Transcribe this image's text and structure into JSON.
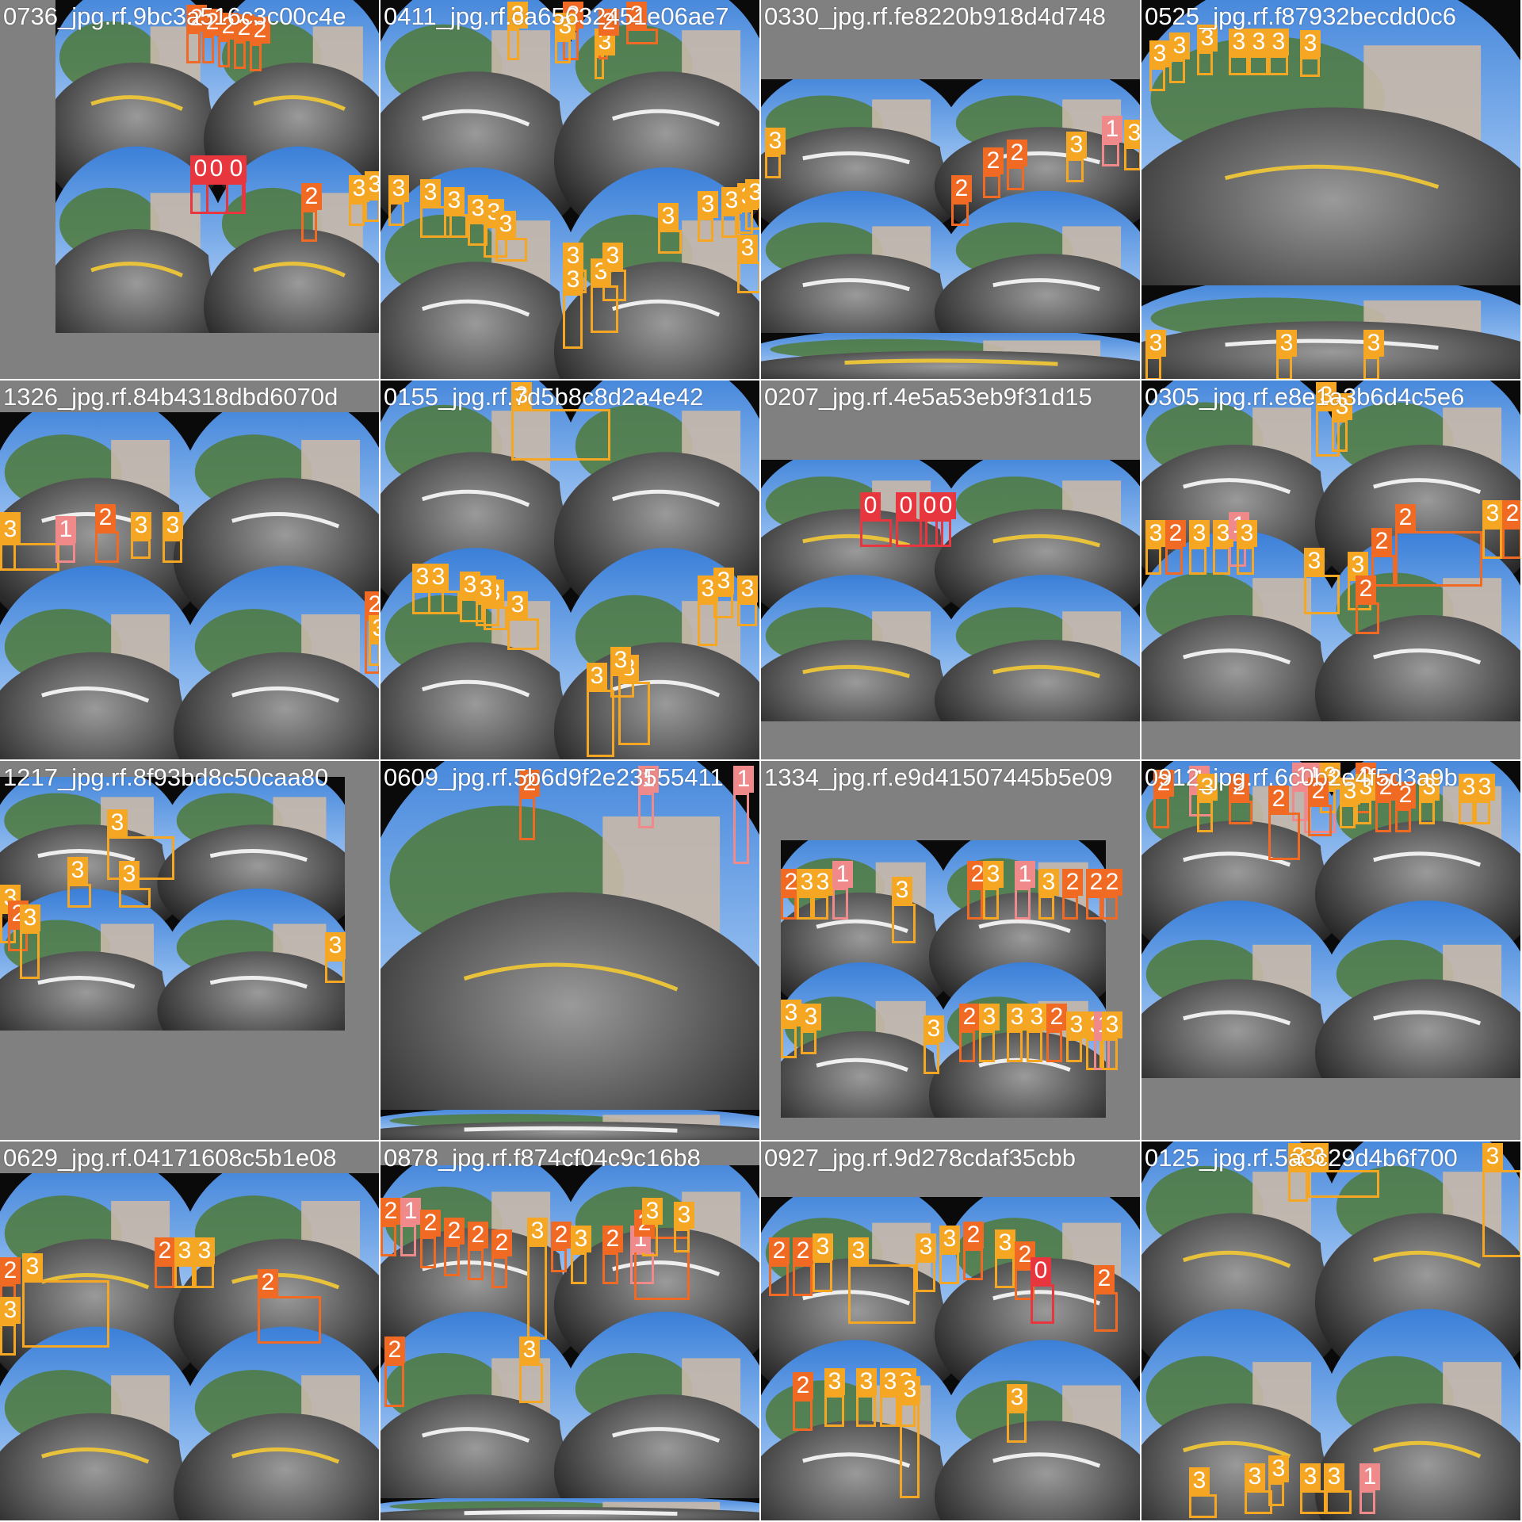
{
  "colors": {
    "class_0": "#e8363f",
    "class_1": "#f08a8a",
    "class_2": "#f06a24",
    "class_3": "#f5a623",
    "padding_gray": "#808080"
  },
  "mosaic": [
    {
      "filename": "0736_jpg.rf.9bc3a516c3c00c4e",
      "labels": [
        "2",
        "2",
        "2",
        "2",
        "2",
        "0",
        "0",
        "0",
        "0",
        "2",
        "3",
        "3"
      ]
    },
    {
      "filename": "0411_jpg.rf.ca65632451e06ae7",
      "labels": [
        "3",
        "2",
        "2",
        "3",
        "2",
        "3",
        "3",
        "3",
        "3",
        "3",
        "3",
        "3",
        "3",
        "3",
        "3",
        "3",
        "3",
        "3",
        "3",
        "3",
        "3",
        "3"
      ]
    },
    {
      "filename": "0330_jpg.rf.fe8220b918d4d748",
      "labels": [
        "3",
        "2",
        "2",
        "3",
        "1",
        "3",
        "2"
      ]
    },
    {
      "filename": "0525_jpg.rf.f87932becdd0c6",
      "labels": [
        "3",
        "3",
        "3",
        "3",
        "3",
        "3",
        "3",
        "3",
        "3",
        "3"
      ]
    },
    {
      "filename": "1326_jpg.rf.84b4318dbd6070d",
      "labels": [
        "3",
        "3",
        "1",
        "2",
        "3",
        "3",
        "2",
        "3"
      ]
    },
    {
      "filename": "0155_jpg.rf.7d5b8c8d2a4e42",
      "labels": [
        "3",
        "3",
        "3",
        "3",
        "3",
        "3",
        "3",
        "3",
        "3",
        "3",
        "3",
        "3",
        "3"
      ]
    },
    {
      "filename": "0207_jpg.rf.4e5a53eb9f31d15",
      "labels": [
        "0",
        "0",
        "0",
        "0"
      ]
    },
    {
      "filename": "0305_jpg.rf.e8e1a3b6d4c5e6",
      "labels": [
        "3",
        "3",
        "3",
        "2",
        "3",
        "3",
        "1",
        "3",
        "3",
        "3",
        "2",
        "2",
        "3",
        "2",
        "2"
      ]
    },
    {
      "filename": "1217_jpg.rf.8f93bd8c50caa80",
      "labels": [
        "3",
        "3",
        "3",
        "3",
        "2",
        "3",
        "3"
      ]
    },
    {
      "filename": "0609_jpg.rf.5b6d9f2e23555411",
      "labels": [
        "2",
        "1",
        "1"
      ]
    },
    {
      "filename": "1334_jpg.rf.e9d41507445b5e09",
      "labels": [
        "2",
        "3",
        "3",
        "1",
        "3",
        "2",
        "3",
        "1",
        "3",
        "2",
        "2",
        "2",
        "3",
        "3",
        "3",
        "2",
        "3",
        "3",
        "3",
        "2",
        "3",
        "3",
        "1",
        "3"
      ]
    },
    {
      "filename": "0912_jpg.rf.6c0b2e4f5d3a9b",
      "labels": [
        "1",
        "1",
        "1",
        "3",
        "2",
        "2",
        "3",
        "2",
        "2",
        "2",
        "3",
        "3",
        "2",
        "2",
        "3",
        "3",
        "3"
      ]
    },
    {
      "filename": "0629_jpg.rf.04171608c5b1e08",
      "labels": [
        "3",
        "2",
        "2",
        "3",
        "3",
        "3",
        "2"
      ]
    },
    {
      "filename": "0878_jpg.rf.f874cf04c9c16b8",
      "labels": [
        "2",
        "1",
        "2",
        "2",
        "2",
        "2",
        "3",
        "2",
        "3",
        "2",
        "1",
        "2",
        "3",
        "3",
        "2",
        "3"
      ]
    },
    {
      "filename": "0927_jpg.rf.9d278cdaf35cbb",
      "labels": [
        "2",
        "2",
        "3",
        "3",
        "3",
        "3",
        "2",
        "3",
        "2",
        "0",
        "2",
        "2",
        "3",
        "3",
        "3",
        "3",
        "3",
        "3"
      ]
    },
    {
      "filename": "0125_jpg.rf.5a3c29d4b6f700",
      "labels": [
        "3",
        "3",
        "3",
        "3",
        "3",
        "3",
        "3",
        "3",
        "1"
      ]
    }
  ]
}
